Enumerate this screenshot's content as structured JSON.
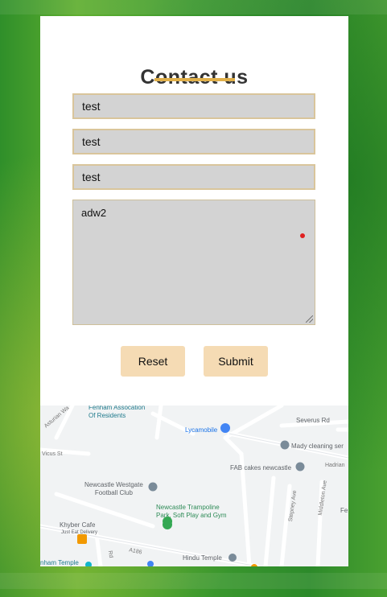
{
  "contact": {
    "title": "Contact us",
    "fields": [
      "test",
      "test",
      "test"
    ],
    "message": "adw2",
    "reset_label": "Reset",
    "submit_label": "Submit",
    "accent_color": "#e0b04a",
    "button_color": "#f5dbb4"
  },
  "map": {
    "labels": {
      "fenham": "Fenham Assocation\nOf Residents",
      "lycamobile": "Lycamobile",
      "severus": "Severus Rd",
      "mady": "Mady cleaning ser",
      "hadrian": "Hadrian",
      "fab": "FAB cakes newcastle",
      "asturian": "Asturian Wa",
      "vicus": "Vicus St",
      "westgate": "Newcastle Westgate\nFootball Club",
      "trampoline": "Newcastle Trampoline\nPark, Soft Play and Gym",
      "stepney": "Stepney Ave",
      "middleton": "Middleton Ave",
      "fe": "Fe",
      "khyber": "Khyber Cafe",
      "just_eat": "Just Eat Delivery",
      "rd": "Rd",
      "a186": "A186",
      "hindu": "Hindu Temple",
      "fenham_temple": "nham Temple"
    }
  }
}
